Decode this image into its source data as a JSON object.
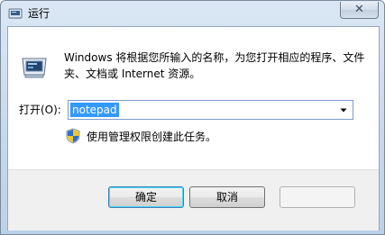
{
  "window": {
    "title": "运行",
    "title_icon": "run-icon",
    "close_glyph": "✕"
  },
  "dialog": {
    "icon": "run-program-icon",
    "description": "Windows 将根据您所输入的名称，为您打开相应的程序、文件夹、文档或 Internet 资源。",
    "open_label": "打开(O):",
    "open_value": "notepad",
    "admin_icon": "uac-shield-icon",
    "admin_text": "使用管理权限创建此任务。"
  },
  "buttons": {
    "ok": "确定",
    "cancel": "取消",
    "browse": ""
  },
  "colors": {
    "selection": "#3399ff",
    "frame": "#c6d8ec",
    "ok_border": "#3c7fb1"
  }
}
